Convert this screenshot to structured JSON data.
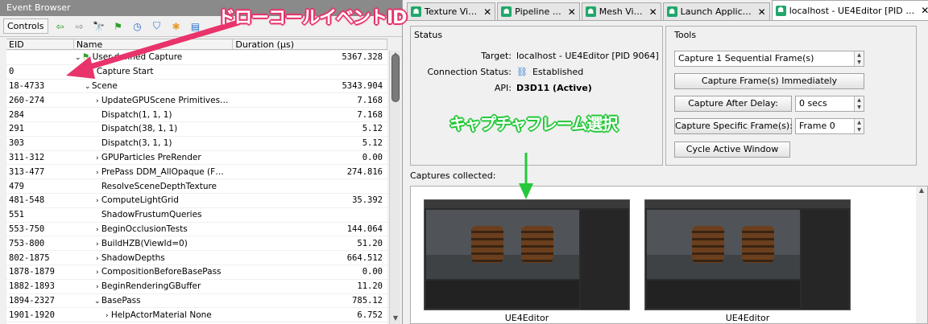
{
  "event_browser": {
    "title": "Event Browser",
    "controls_label": "Controls",
    "toolbar_icons": [
      "arrow-left-icon",
      "arrow-right-icon",
      "find-icon",
      "bookmark-flag-icon",
      "timer-icon",
      "filter-icon",
      "settings-icon",
      "export-icon"
    ],
    "columns": {
      "eid": "EID",
      "name": "Name",
      "duration": "Duration (µs)"
    },
    "rows": [
      {
        "eid": "",
        "exp": "v",
        "name": "User-defined Capture",
        "dur": "5367.328"
      },
      {
        "eid": "0",
        "exp": "",
        "name": "Capture Start",
        "dur": ""
      },
      {
        "eid": "18-4733",
        "exp": "v",
        "name": "Scene",
        "dur": "5343.904"
      },
      {
        "eid": "260-274",
        "exp": ">",
        "name": "UpdateGPUScene Primitives…",
        "dur": "7.168"
      },
      {
        "eid": "284",
        "exp": "",
        "name": "Dispatch(1, 1, 1)",
        "dur": "7.168"
      },
      {
        "eid": "291",
        "exp": "",
        "name": "Dispatch(38, 1, 1)",
        "dur": "5.12"
      },
      {
        "eid": "303",
        "exp": "",
        "name": "Dispatch(3, 1, 1)",
        "dur": "5.12"
      },
      {
        "eid": "311-312",
        "exp": ">",
        "name": "GPUParticles PreRender",
        "dur": "0.00"
      },
      {
        "eid": "313-477",
        "exp": ">",
        "name": "PrePass DDM_AllOpaque (F…",
        "dur": "274.816"
      },
      {
        "eid": "479",
        "exp": "",
        "name": "ResolveSceneDepthTexture",
        "dur": ""
      },
      {
        "eid": "481-548",
        "exp": ">",
        "name": "ComputeLightGrid",
        "dur": "35.392"
      },
      {
        "eid": "551",
        "exp": "",
        "name": "ShadowFrustumQueries",
        "dur": ""
      },
      {
        "eid": "553-750",
        "exp": ">",
        "name": "BeginOcclusionTests",
        "dur": "144.064"
      },
      {
        "eid": "753-800",
        "exp": ">",
        "name": "BuildHZB(ViewId=0)",
        "dur": "51.20"
      },
      {
        "eid": "802-1875",
        "exp": ">",
        "name": "ShadowDepths",
        "dur": "664.512"
      },
      {
        "eid": "1878-1879",
        "exp": ">",
        "name": "CompositionBeforeBasePass",
        "dur": "0.00"
      },
      {
        "eid": "1882-1893",
        "exp": ">",
        "name": "BeginRenderingGBuffer",
        "dur": "11.20"
      },
      {
        "eid": "1894-2327",
        "exp": "v",
        "name": "BasePass",
        "dur": "785.12"
      },
      {
        "eid": "1901-1920",
        "exp": ">",
        "name": "HelpActorMaterial None",
        "dur": "6.752"
      }
    ]
  },
  "tabs": [
    {
      "label": "Texture Vi…",
      "active": false
    },
    {
      "label": "Pipeline …",
      "active": false
    },
    {
      "label": "Mesh Vi…",
      "active": false
    },
    {
      "label": "Launch Applic…",
      "active": false
    },
    {
      "label": "localhost - UE4Editor [PID …",
      "active": true
    }
  ],
  "status": {
    "legend": "Status",
    "target_label": "Target:",
    "target_value": "localhost - UE4Editor [PID 9064]",
    "connection_label": "Connection Status:",
    "connection_value": "Established",
    "api_label": "API:",
    "api_value": "D3D11 (Active)"
  },
  "tools": {
    "legend": "Tools",
    "capture_mode": "Capture 1 Sequential Frame(s)",
    "capture_now": "Capture Frame(s) Immediately",
    "capture_delay": "Capture After Delay:",
    "delay_value": "0 secs",
    "capture_specific": "Capture Specific Frame(s):",
    "frame_value": "Frame 0",
    "cycle_window": "Cycle Active Window"
  },
  "captures": {
    "label": "Captures collected:",
    "items": [
      "UE4Editor",
      "UE4Editor"
    ]
  },
  "annotations": {
    "top": "ドローコールイベントID",
    "middle": "キャプチャフレーム選択"
  },
  "colors": {
    "annotation_pink": "#e8336b",
    "annotation_green": "#25c83a",
    "tab_icon_green": "#1fa86a"
  }
}
